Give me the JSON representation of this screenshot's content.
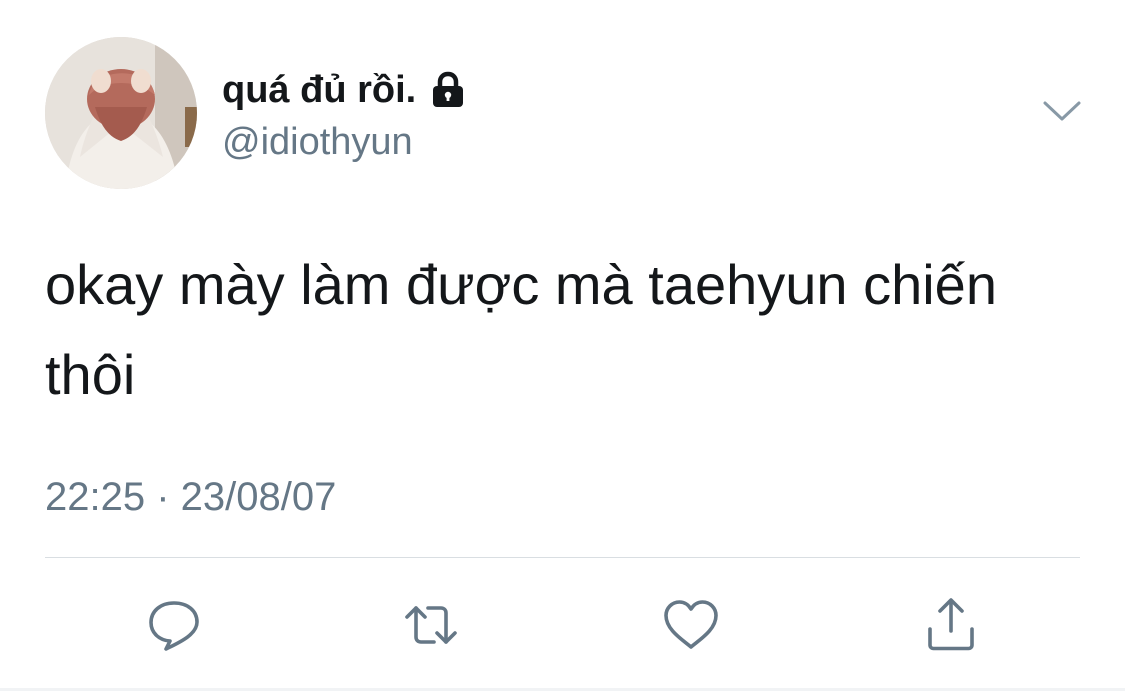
{
  "author": {
    "display_name": "quá đủ rồi.",
    "handle": "@idiothyun",
    "protected": true
  },
  "tweet": {
    "text": "okay mày làm được mà taehyun chiến\nthôi",
    "timestamp": "22:25 · 23/08/07"
  },
  "icons": {
    "lock": "lock-icon",
    "caret": "chevron-down-icon",
    "reply": "reply-icon",
    "retweet": "retweet-icon",
    "like": "heart-icon",
    "share": "share-icon"
  },
  "colors": {
    "primary_text": "#14171a",
    "secondary_text": "#657786",
    "icon": "#657786",
    "divider": "#d9dee2",
    "background": "#ffffff"
  }
}
